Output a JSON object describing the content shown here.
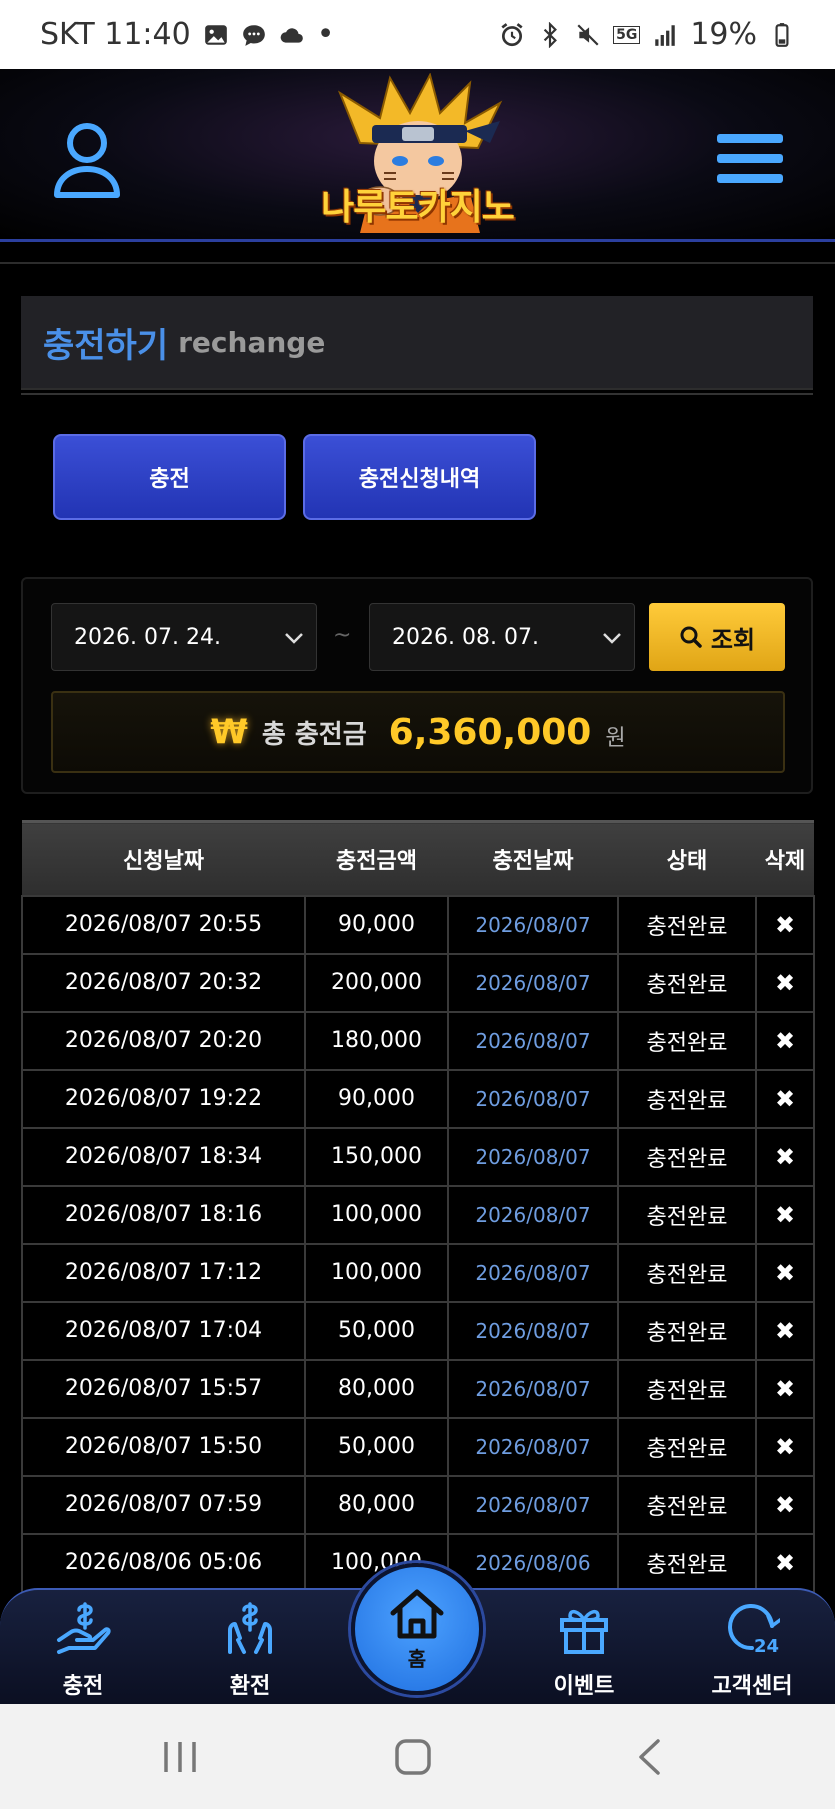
{
  "status_bar": {
    "carrier_time": "SKT 11:40",
    "dot": "•",
    "battery": "19%",
    "network": "5G"
  },
  "header": {
    "logo_text": "나루토카지노",
    "user_icon": "user-icon",
    "menu_icon": "hamburger-menu-icon"
  },
  "page_title": {
    "ko": "충전하기",
    "en": "rechange"
  },
  "tabs": [
    {
      "label": "충전"
    },
    {
      "label": "충전신청내역"
    }
  ],
  "filter": {
    "start_date": "2026. 07. 24.",
    "separator": "~",
    "end_date": "2026. 08. 07.",
    "search_label": "조회"
  },
  "total": {
    "symbol": "₩",
    "label": "총 충전금",
    "amount": "6,360,000",
    "unit": "원"
  },
  "table": {
    "headers": [
      "신청날짜",
      "충전금액",
      "충전날짜",
      "상태",
      "삭제"
    ],
    "rows": [
      {
        "request": "2026/08/07 20:55",
        "amount": "90,000",
        "charge_date": "2026/08/07",
        "status": "충전완료",
        "delete": "✖"
      },
      {
        "request": "2026/08/07 20:32",
        "amount": "200,000",
        "charge_date": "2026/08/07",
        "status": "충전완료",
        "delete": "✖"
      },
      {
        "request": "2026/08/07 20:20",
        "amount": "180,000",
        "charge_date": "2026/08/07",
        "status": "충전완료",
        "delete": "✖"
      },
      {
        "request": "2026/08/07 19:22",
        "amount": "90,000",
        "charge_date": "2026/08/07",
        "status": "충전완료",
        "delete": "✖"
      },
      {
        "request": "2026/08/07 18:34",
        "amount": "150,000",
        "charge_date": "2026/08/07",
        "status": "충전완료",
        "delete": "✖"
      },
      {
        "request": "2026/08/07 18:16",
        "amount": "100,000",
        "charge_date": "2026/08/07",
        "status": "충전완료",
        "delete": "✖"
      },
      {
        "request": "2026/08/07 17:12",
        "amount": "100,000",
        "charge_date": "2026/08/07",
        "status": "충전완료",
        "delete": "✖"
      },
      {
        "request": "2026/08/07 17:04",
        "amount": "50,000",
        "charge_date": "2026/08/07",
        "status": "충전완료",
        "delete": "✖"
      },
      {
        "request": "2026/08/07 15:57",
        "amount": "80,000",
        "charge_date": "2026/08/07",
        "status": "충전완료",
        "delete": "✖"
      },
      {
        "request": "2026/08/07 15:50",
        "amount": "50,000",
        "charge_date": "2026/08/07",
        "status": "충전완료",
        "delete": "✖"
      },
      {
        "request": "2026/08/07 07:59",
        "amount": "80,000",
        "charge_date": "2026/08/07",
        "status": "충전완료",
        "delete": "✖"
      },
      {
        "request": "2026/08/06 05:06",
        "amount": "100,000",
        "charge_date": "2026/08/06",
        "status": "충전완료",
        "delete": "✖"
      }
    ]
  },
  "bottom_nav": {
    "items": [
      {
        "label": "충전",
        "icon": "deposit-hand-icon"
      },
      {
        "label": "환전",
        "icon": "exchange-hands-icon"
      },
      {
        "label": "홈",
        "icon": "home-icon"
      },
      {
        "label": "이벤트",
        "icon": "gift-icon"
      },
      {
        "label": "고객센터",
        "icon": "support-24-icon"
      }
    ]
  },
  "colors": {
    "accent_blue": "#4a90e8",
    "tab_blue": "#2f43c8",
    "gold": "#ffc928",
    "nav_blue": "#2f7ff0"
  }
}
